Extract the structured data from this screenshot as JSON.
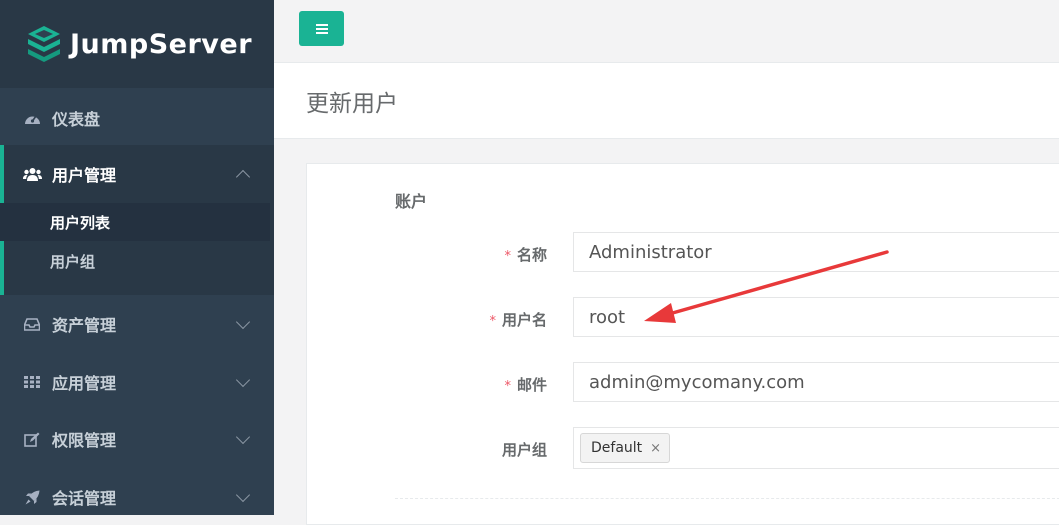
{
  "brand": {
    "name": "JumpServer",
    "logo_icon": "jumpserver-logo-icon"
  },
  "sidebar": {
    "items": [
      {
        "label": "仪表盘",
        "icon": "dashboard-icon"
      },
      {
        "label": "用户管理",
        "icon": "users-icon",
        "expanded": true,
        "children": [
          {
            "label": "用户列表"
          },
          {
            "label": "用户组"
          }
        ]
      },
      {
        "label": "资产管理",
        "icon": "inbox-icon"
      },
      {
        "label": "应用管理",
        "icon": "grid-icon"
      },
      {
        "label": "权限管理",
        "icon": "edit-icon"
      },
      {
        "label": "会话管理",
        "icon": "rocket-icon"
      }
    ]
  },
  "topbar": {
    "menu_icon": "hamburger-icon"
  },
  "page": {
    "title": "更新用户"
  },
  "form": {
    "section_title": "账户",
    "fields": [
      {
        "label": "名称",
        "required": true,
        "value": "Administrator"
      },
      {
        "label": "用户名",
        "required": true,
        "value": "root"
      },
      {
        "label": "邮件",
        "required": true,
        "value": "admin@mycomany.com"
      },
      {
        "label": "用户组",
        "required": false,
        "tags": [
          {
            "label": "Default",
            "remove": "×"
          }
        ]
      }
    ]
  },
  "colors": {
    "sidebar_bg": "#2f4050",
    "accent": "#1ab394",
    "required": "#ed5565",
    "annotation_arrow": "#e8393a"
  }
}
